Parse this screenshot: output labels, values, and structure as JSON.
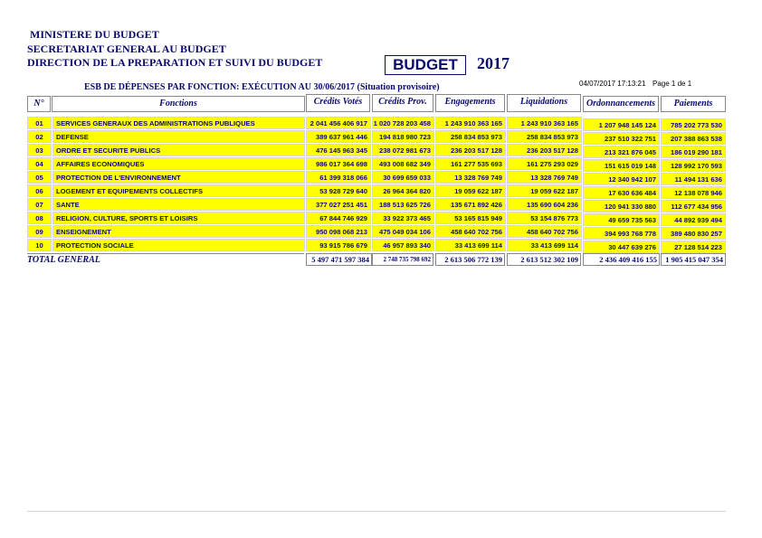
{
  "header": {
    "line1": "MINISTERE DU BUDGET",
    "line2": "SECRETARIAT GENERAL AU BUDGET",
    "line3": "DIRECTION DE LA PREPARATION ET SUIVI DU BUDGET",
    "budget_label": "BUDGET",
    "year": "2017",
    "timestamp": "04/07/2017 17:13:21",
    "page": "Page 1 de 1",
    "subtitle": "ESB DE DÉPENSES  PAR FONCTION: EXÉCUTION AU 30/06/2017 (Situation provisoire)"
  },
  "columns": {
    "no": "N°",
    "fonctions": "Fonctions",
    "credits_votes": "Crédits Votés",
    "credits_prov": "Crédits Prov.",
    "engagements": "Engagements",
    "liquidations": "Liquidations",
    "ordonnancements": "Ordonnancements",
    "paiements": "Paiements"
  },
  "rows": [
    {
      "no": "01",
      "fonction": "SERVICES GENERAUX DES ADMINISTRATIONS PUBLIQUES",
      "credits_votes": "2 041 456 406 917",
      "credits_prov": "1 020 728 203 458",
      "engagements": "1 243 910 363 165",
      "liquidations": "1 243 910 363 165",
      "ordonnancements": "1 207 948 145 124",
      "paiements": "785 202 773 530"
    },
    {
      "no": "02",
      "fonction": "DEFENSE",
      "credits_votes": "389 637 961 446",
      "credits_prov": "194 818 980 723",
      "engagements": "258 834 853 973",
      "liquidations": "258 834 853 973",
      "ordonnancements": "237 510 322 751",
      "paiements": "207 388 863 538"
    },
    {
      "no": "03",
      "fonction": "ORDRE ET SECURITE PUBLICS",
      "credits_votes": "476 145 963 345",
      "credits_prov": "238 072 981 673",
      "engagements": "236 203 517 128",
      "liquidations": "236 203 517 128",
      "ordonnancements": "213 321 876 045",
      "paiements": "186 019 290 181"
    },
    {
      "no": "04",
      "fonction": "AFFAIRES ECONOMIQUES",
      "credits_votes": "986 017 364 698",
      "credits_prov": "493 008 682 349",
      "engagements": "161 277 535 693",
      "liquidations": "161 275 293 029",
      "ordonnancements": "151 615 019 148",
      "paiements": "128 992 170 593"
    },
    {
      "no": "05",
      "fonction": "PROTECTION DE L'ENVIRONNEMENT",
      "credits_votes": "61 399 318 066",
      "credits_prov": "30 699 659 033",
      "engagements": "13 328 769 749",
      "liquidations": "13 328 769 749",
      "ordonnancements": "12 340 942 107",
      "paiements": "11 494 131 636"
    },
    {
      "no": "06",
      "fonction": "LOGEMENT ET EQUIPEMENTS COLLECTIFS",
      "credits_votes": "53 928 729 640",
      "credits_prov": "26 964 364 820",
      "engagements": "19 059 622 187",
      "liquidations": "19 059 622 187",
      "ordonnancements": "17 630 636 484",
      "paiements": "12 138 078 946"
    },
    {
      "no": "07",
      "fonction": "SANTE",
      "credits_votes": "377 027 251 451",
      "credits_prov": "188 513 625 726",
      "engagements": "135 671 892 426",
      "liquidations": "135 690 604 236",
      "ordonnancements": "120 941 330 880",
      "paiements": "112 677 434 956"
    },
    {
      "no": "08",
      "fonction": "RELIGION, CULTURE, SPORTS ET LOISIRS",
      "credits_votes": "67 844 746 929",
      "credits_prov": "33 922 373 465",
      "engagements": "53 165 815 949",
      "liquidations": "53 154 876 773",
      "ordonnancements": "49 659 735 563",
      "paiements": "44 892 939 494"
    },
    {
      "no": "09",
      "fonction": "ENSEIGNEMENT",
      "credits_votes": "950 098 068 213",
      "credits_prov": "475 049 034 106",
      "engagements": "458 640 702 756",
      "liquidations": "458 640 702 756",
      "ordonnancements": "394 993 768 778",
      "paiements": "389 480 830 257"
    },
    {
      "no": "10",
      "fonction": "PROTECTION SOCIALE",
      "credits_votes": "93 915 786 679",
      "credits_prov": "46 957 893 340",
      "engagements": "33 413 699 114",
      "liquidations": "33 413 699 114",
      "ordonnancements": "30 447 639 276",
      "paiements": "27 128 514 223"
    }
  ],
  "total": {
    "label": "TOTAL GENERAL",
    "credits_votes": "5 497 471 597 384",
    "credits_prov": "2 748 735 798 692",
    "engagements": "2 613 506 772 139",
    "liquidations": "2 613 512 302 109",
    "ordonnancements": "2 436 409 416 155",
    "paiements": "1 905 415 047 354"
  },
  "colors": {
    "row_fill": "#ffff00",
    "text_navy": "#0a0a6e"
  }
}
